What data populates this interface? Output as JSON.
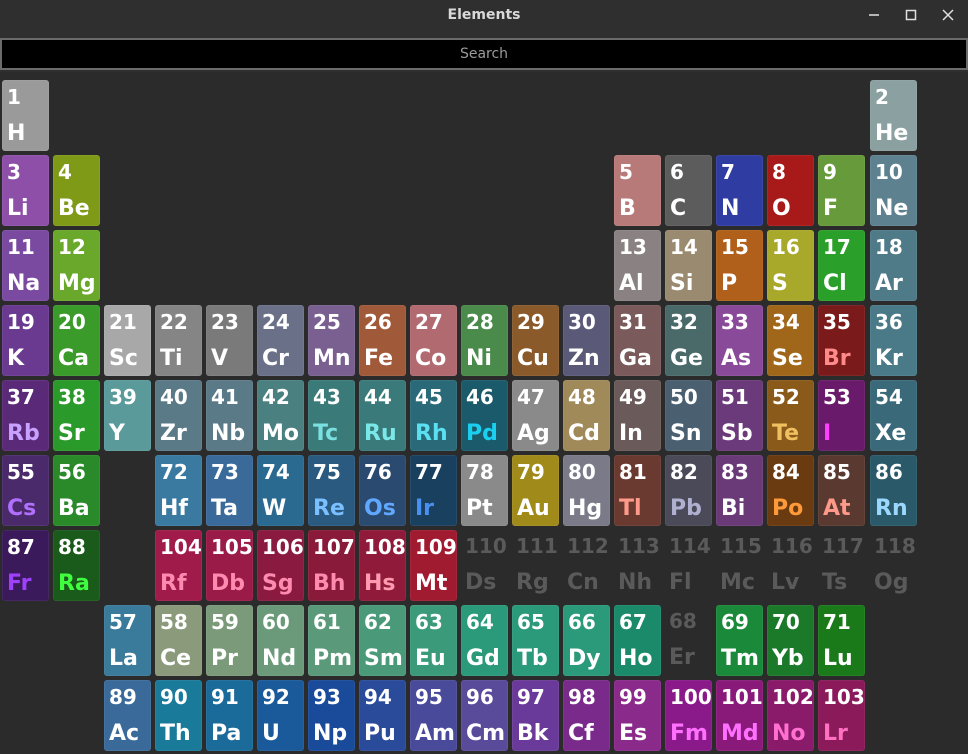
{
  "window": {
    "title": "Elements",
    "controls": {
      "minimize": "minimize-icon",
      "maximize": "maximize-icon",
      "close": "close-icon"
    }
  },
  "search": {
    "placeholder": "Search",
    "value": ""
  },
  "elements": [
    {
      "n": "1",
      "s": "H",
      "bg": "#9a9a9a",
      "fg": "#ffffff"
    },
    {
      "n": "2",
      "s": "He",
      "bg": "#8ba0a0",
      "fg": "#ffffff"
    },
    {
      "n": "3",
      "s": "Li",
      "bg": "#8d4fa8",
      "fg": "#ffffff"
    },
    {
      "n": "4",
      "s": "Be",
      "bg": "#7f9a17",
      "fg": "#ffffff"
    },
    {
      "n": "5",
      "s": "B",
      "bg": "#b87a78",
      "fg": "#ffffff"
    },
    {
      "n": "6",
      "s": "C",
      "bg": "#5c5c5c",
      "fg": "#ffffff"
    },
    {
      "n": "7",
      "s": "N",
      "bg": "#2f3da3",
      "fg": "#ffffff"
    },
    {
      "n": "8",
      "s": "O",
      "bg": "#a81a1a",
      "fg": "#ffffff"
    },
    {
      "n": "9",
      "s": "F",
      "bg": "#679a3a",
      "fg": "#ffffff"
    },
    {
      "n": "10",
      "s": "Ne",
      "bg": "#5e8190",
      "fg": "#ffffff"
    },
    {
      "n": "11",
      "s": "Na",
      "bg": "#7a4aa0",
      "fg": "#ffffff"
    },
    {
      "n": "12",
      "s": "Mg",
      "bg": "#69a82a",
      "fg": "#ffffff"
    },
    {
      "n": "13",
      "s": "Al",
      "bg": "#8a8282",
      "fg": "#ffffff"
    },
    {
      "n": "14",
      "s": "Si",
      "bg": "#9a8a70",
      "fg": "#ffffff"
    },
    {
      "n": "15",
      "s": "P",
      "bg": "#b0601a",
      "fg": "#ffffff"
    },
    {
      "n": "16",
      "s": "S",
      "bg": "#a8a82a",
      "fg": "#ffffff"
    },
    {
      "n": "17",
      "s": "Cl",
      "bg": "#2aa02a",
      "fg": "#ffffff"
    },
    {
      "n": "18",
      "s": "Ar",
      "bg": "#4f7a88",
      "fg": "#ffffff"
    },
    {
      "n": "19",
      "s": "K",
      "bg": "#6a3a90",
      "fg": "#ffffff"
    },
    {
      "n": "20",
      "s": "Ca",
      "bg": "#3a9a2a",
      "fg": "#ffffff"
    },
    {
      "n": "21",
      "s": "Sc",
      "bg": "#a8a8a8",
      "fg": "#ffffff"
    },
    {
      "n": "22",
      "s": "Ti",
      "bg": "#858585",
      "fg": "#ffffff"
    },
    {
      "n": "23",
      "s": "V",
      "bg": "#7a7a7a",
      "fg": "#ffffff"
    },
    {
      "n": "24",
      "s": "Cr",
      "bg": "#6a7088",
      "fg": "#ffffff"
    },
    {
      "n": "25",
      "s": "Mn",
      "bg": "#7a6090",
      "fg": "#ffffff"
    },
    {
      "n": "26",
      "s": "Fe",
      "bg": "#a05a3a",
      "fg": "#ffffff"
    },
    {
      "n": "27",
      "s": "Co",
      "bg": "#b06a70",
      "fg": "#ffffff"
    },
    {
      "n": "28",
      "s": "Ni",
      "bg": "#4a8a4a",
      "fg": "#ffffff"
    },
    {
      "n": "29",
      "s": "Cu",
      "bg": "#8a5a2a",
      "fg": "#ffffff"
    },
    {
      "n": "30",
      "s": "Zn",
      "bg": "#5a5a78",
      "fg": "#ffffff"
    },
    {
      "n": "31",
      "s": "Ga",
      "bg": "#7a5a5a",
      "fg": "#ffffff"
    },
    {
      "n": "32",
      "s": "Ge",
      "bg": "#4a6a6a",
      "fg": "#ffffff"
    },
    {
      "n": "33",
      "s": "As",
      "bg": "#8a4a9a",
      "fg": "#ffffff"
    },
    {
      "n": "34",
      "s": "Se",
      "bg": "#a0661a",
      "fg": "#ffffff"
    },
    {
      "n": "35",
      "s": "Br",
      "bg": "#7a1a1a",
      "fg": "#ff8a8a"
    },
    {
      "n": "36",
      "s": "Kr",
      "bg": "#4a7a88",
      "fg": "#ffffff"
    },
    {
      "n": "37",
      "s": "Rb",
      "bg": "#5a2a78",
      "fg": "#c8a0ff"
    },
    {
      "n": "38",
      "s": "Sr",
      "bg": "#2a9a2a",
      "fg": "#ffffff"
    },
    {
      "n": "39",
      "s": "Y",
      "bg": "#5a9a9a",
      "fg": "#ffffff"
    },
    {
      "n": "40",
      "s": "Zr",
      "bg": "#5a7a88",
      "fg": "#ffffff"
    },
    {
      "n": "41",
      "s": "Nb",
      "bg": "#5a7a88",
      "fg": "#ffffff"
    },
    {
      "n": "42",
      "s": "Mo",
      "bg": "#4a8080",
      "fg": "#ffffff"
    },
    {
      "n": "43",
      "s": "Tc",
      "bg": "#3a7a78",
      "fg": "#7ae0e0"
    },
    {
      "n": "44",
      "s": "Ru",
      "bg": "#3a7a7a",
      "fg": "#7ae8e8"
    },
    {
      "n": "45",
      "s": "Rh",
      "bg": "#2a6a78",
      "fg": "#5ae0f0"
    },
    {
      "n": "46",
      "s": "Pd",
      "bg": "#1a5a6a",
      "fg": "#1ad0f0"
    },
    {
      "n": "47",
      "s": "Ag",
      "bg": "#8a8a8a",
      "fg": "#ffffff"
    },
    {
      "n": "48",
      "s": "Cd",
      "bg": "#a08a5a",
      "fg": "#ffffff"
    },
    {
      "n": "49",
      "s": "In",
      "bg": "#6a5a5a",
      "fg": "#ffffff"
    },
    {
      "n": "50",
      "s": "Sn",
      "bg": "#4a6070",
      "fg": "#ffffff"
    },
    {
      "n": "51",
      "s": "Sb",
      "bg": "#6a3a7a",
      "fg": "#ffffff"
    },
    {
      "n": "52",
      "s": "Te",
      "bg": "#8a5a1a",
      "fg": "#f0c060"
    },
    {
      "n": "53",
      "s": "I",
      "bg": "#6a1a6a",
      "fg": "#ff40ff"
    },
    {
      "n": "54",
      "s": "Xe",
      "bg": "#3a6a7a",
      "fg": "#ffffff"
    },
    {
      "n": "55",
      "s": "Cs",
      "bg": "#4a2a6a",
      "fg": "#b070ff"
    },
    {
      "n": "56",
      "s": "Ba",
      "bg": "#2a8a2a",
      "fg": "#ffffff"
    },
    {
      "n": "72",
      "s": "Hf",
      "bg": "#3a7aa0",
      "fg": "#ffffff"
    },
    {
      "n": "73",
      "s": "Ta",
      "bg": "#3a6a9a",
      "fg": "#ffffff"
    },
    {
      "n": "74",
      "s": "W",
      "bg": "#2a6a90",
      "fg": "#ffffff"
    },
    {
      "n": "75",
      "s": "Re",
      "bg": "#2a5a80",
      "fg": "#7ac0ff"
    },
    {
      "n": "76",
      "s": "Os",
      "bg": "#2a4a70",
      "fg": "#60a8ff"
    },
    {
      "n": "77",
      "s": "Ir",
      "bg": "#1a4060",
      "fg": "#4a90f0"
    },
    {
      "n": "78",
      "s": "Pt",
      "bg": "#8a8a8a",
      "fg": "#ffffff"
    },
    {
      "n": "79",
      "s": "Au",
      "bg": "#a08a1a",
      "fg": "#ffffff"
    },
    {
      "n": "80",
      "s": "Hg",
      "bg": "#7a7a88",
      "fg": "#ffffff"
    },
    {
      "n": "81",
      "s": "Tl",
      "bg": "#6a3a30",
      "fg": "#ff9a8a"
    },
    {
      "n": "82",
      "s": "Pb",
      "bg": "#4a4a58",
      "fg": "#b0b0d0"
    },
    {
      "n": "83",
      "s": "Bi",
      "bg": "#6a3a78",
      "fg": "#ffffff"
    },
    {
      "n": "84",
      "s": "Po",
      "bg": "#6a3a10",
      "fg": "#ff9a3a"
    },
    {
      "n": "85",
      "s": "At",
      "bg": "#5a3a30",
      "fg": "#ff9a8a"
    },
    {
      "n": "86",
      "s": "Rn",
      "bg": "#2a5a6a",
      "fg": "#9ad8ff"
    },
    {
      "n": "87",
      "s": "Fr",
      "bg": "#3a1a5a",
      "fg": "#a040ff"
    },
    {
      "n": "88",
      "s": "Ra",
      "bg": "#1a5a1a",
      "fg": "#40ff40"
    },
    {
      "n": "104",
      "s": "Rf",
      "bg": "#a01a4a",
      "fg": "#ff8ab0"
    },
    {
      "n": "105",
      "s": "Db",
      "bg": "#9a1a48",
      "fg": "#ff8ab0"
    },
    {
      "n": "106",
      "s": "Sg",
      "bg": "#8a1a40",
      "fg": "#ff8ab0"
    },
    {
      "n": "107",
      "s": "Bh",
      "bg": "#8a1a3a",
      "fg": "#ff8ab0"
    },
    {
      "n": "108",
      "s": "Hs",
      "bg": "#901a3a",
      "fg": "#ff9ab0"
    },
    {
      "n": "109",
      "s": "Mt",
      "bg": "#a01a30",
      "fg": "#ffffff"
    },
    {
      "n": "110",
      "s": "Ds",
      "bg": "",
      "fg": "#5a5a5a"
    },
    {
      "n": "111",
      "s": "Rg",
      "bg": "",
      "fg": "#5a5a5a"
    },
    {
      "n": "112",
      "s": "Cn",
      "bg": "",
      "fg": "#5a5a5a"
    },
    {
      "n": "113",
      "s": "Nh",
      "bg": "",
      "fg": "#5a5a5a"
    },
    {
      "n": "114",
      "s": "Fl",
      "bg": "",
      "fg": "#5a5a5a"
    },
    {
      "n": "115",
      "s": "Mc",
      "bg": "",
      "fg": "#5a5a5a"
    },
    {
      "n": "116",
      "s": "Lv",
      "bg": "",
      "fg": "#5a5a5a"
    },
    {
      "n": "117",
      "s": "Ts",
      "bg": "",
      "fg": "#5a5a5a"
    },
    {
      "n": "118",
      "s": "Og",
      "bg": "",
      "fg": "#5a5a5a"
    },
    {
      "n": "57",
      "s": "La",
      "bg": "#3a7a9a",
      "fg": "#ffffff"
    },
    {
      "n": "58",
      "s": "Ce",
      "bg": "#8a9a7a",
      "fg": "#ffffff"
    },
    {
      "n": "59",
      "s": "Pr",
      "bg": "#7a9a7a",
      "fg": "#ffffff"
    },
    {
      "n": "60",
      "s": "Nd",
      "bg": "#6a9a7a",
      "fg": "#ffffff"
    },
    {
      "n": "61",
      "s": "Pm",
      "bg": "#5a9a7a",
      "fg": "#ffffff"
    },
    {
      "n": "62",
      "s": "Sm",
      "bg": "#4a9a7a",
      "fg": "#ffffff"
    },
    {
      "n": "63",
      "s": "Eu",
      "bg": "#3a9a7a",
      "fg": "#ffffff"
    },
    {
      "n": "64",
      "s": "Gd",
      "bg": "#2a9a7a",
      "fg": "#ffffff"
    },
    {
      "n": "65",
      "s": "Tb",
      "bg": "#2a9a7a",
      "fg": "#ffffff"
    },
    {
      "n": "66",
      "s": "Dy",
      "bg": "#2a9a7a",
      "fg": "#ffffff"
    },
    {
      "n": "67",
      "s": "Ho",
      "bg": "#1a8a6a",
      "fg": "#ffffff"
    },
    {
      "n": "68",
      "s": "Er",
      "bg": "",
      "fg": "#5a5a5a"
    },
    {
      "n": "69",
      "s": "Tm",
      "bg": "#1a8a3a",
      "fg": "#ffffff"
    },
    {
      "n": "70",
      "s": "Yb",
      "bg": "#1a7a2a",
      "fg": "#ffffff"
    },
    {
      "n": "71",
      "s": "Lu",
      "bg": "#1a7a1a",
      "fg": "#ffffff"
    },
    {
      "n": "89",
      "s": "Ac",
      "bg": "#3a6a9a",
      "fg": "#ffffff"
    },
    {
      "n": "90",
      "s": "Th",
      "bg": "#1a7a9a",
      "fg": "#ffffff"
    },
    {
      "n": "91",
      "s": "Pa",
      "bg": "#1a6a9a",
      "fg": "#ffffff"
    },
    {
      "n": "92",
      "s": "U",
      "bg": "#1a5a9a",
      "fg": "#ffffff"
    },
    {
      "n": "93",
      "s": "Np",
      "bg": "#1a4a9a",
      "fg": "#ffffff"
    },
    {
      "n": "94",
      "s": "Pu",
      "bg": "#2a4a9a",
      "fg": "#ffffff"
    },
    {
      "n": "95",
      "s": "Am",
      "bg": "#4a4a9a",
      "fg": "#ffffff"
    },
    {
      "n": "96",
      "s": "Cm",
      "bg": "#5a4a9a",
      "fg": "#ffffff"
    },
    {
      "n": "97",
      "s": "Bk",
      "bg": "#6a3a9a",
      "fg": "#ffffff"
    },
    {
      "n": "98",
      "s": "Cf",
      "bg": "#7a2a8a",
      "fg": "#ffffff"
    },
    {
      "n": "99",
      "s": "Es",
      "bg": "#8a2a8a",
      "fg": "#ffffff"
    },
    {
      "n": "100",
      "s": "Fm",
      "bg": "#8a1a8a",
      "fg": "#ff70ff"
    },
    {
      "n": "101",
      "s": "Md",
      "bg": "#8a1a7a",
      "fg": "#ff70ff"
    },
    {
      "n": "102",
      "s": "No",
      "bg": "#8a1a6a",
      "fg": "#ff70d0"
    },
    {
      "n": "103",
      "s": "Lr",
      "bg": "#8a1a5a",
      "fg": "#ff70c0"
    }
  ]
}
